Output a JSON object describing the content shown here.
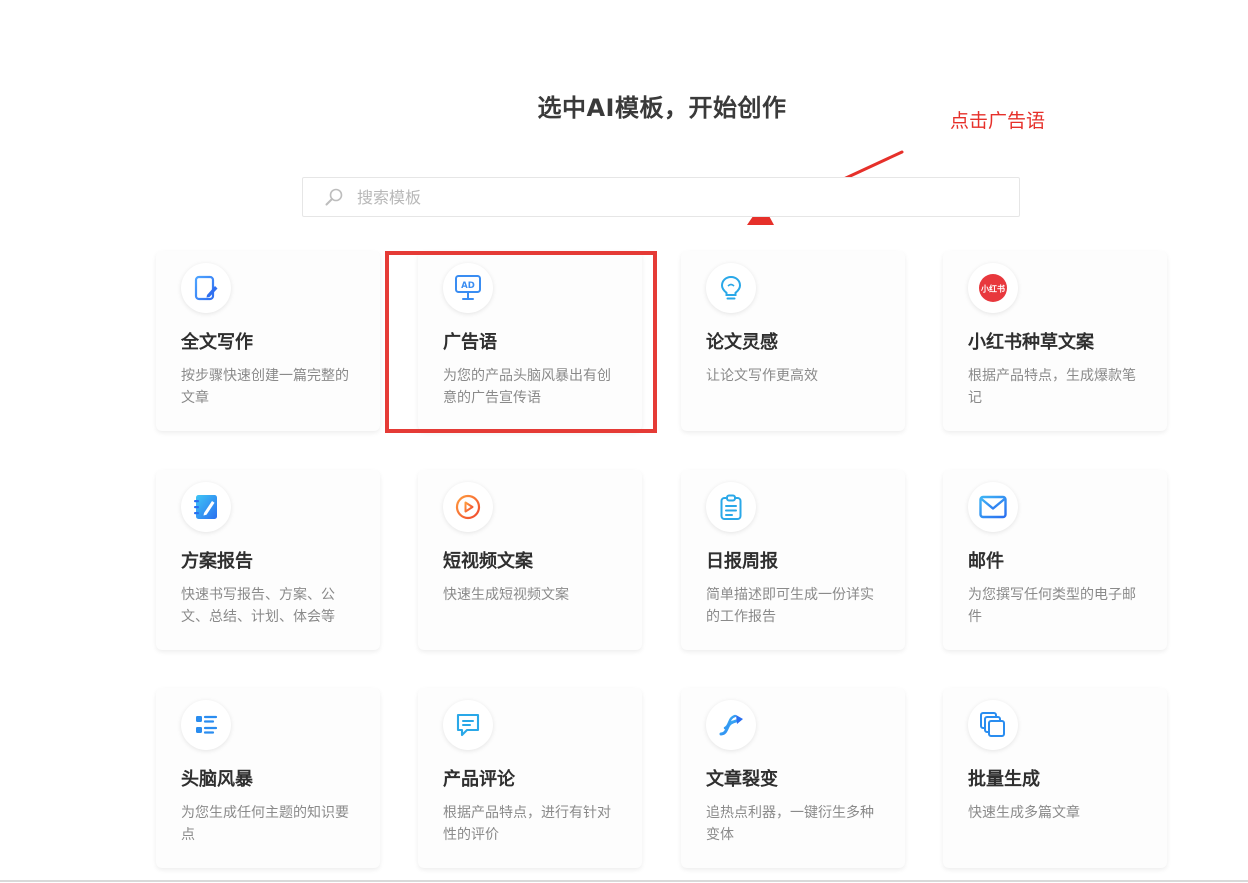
{
  "page": {
    "title": "选中AI模板，开始创作"
  },
  "annotation": {
    "label": "点击广告语",
    "color": "#e6302a"
  },
  "search": {
    "placeholder": "搜索模板",
    "value": "",
    "icon": "search-icon"
  },
  "highlight_color": "#e53b36",
  "cards": [
    {
      "title": "全文写作",
      "desc": "按步骤快速创建一篇完整的文章",
      "icon": "document-edit-icon"
    },
    {
      "title": "广告语",
      "desc": "为您的产品头脑风暴出有创意的广告宣传语",
      "icon": "ad-board-icon",
      "icon_text": "AD"
    },
    {
      "title": "论文灵感",
      "desc": "让论文写作更高效",
      "icon": "lightbulb-icon"
    },
    {
      "title": "小红书种草文案",
      "desc": "根据产品特点，生成爆款笔记",
      "icon": "xiaohongshu-logo-icon",
      "icon_text": "小红书"
    },
    {
      "title": "方案报告",
      "desc": "快速书写报告、方案、公文、总结、计划、体会等",
      "icon": "notebook-pen-icon"
    },
    {
      "title": "短视频文案",
      "desc": "快速生成短视频文案",
      "icon": "play-circle-icon"
    },
    {
      "title": "日报周报",
      "desc": "简单描述即可生成一份详实的工作报告",
      "icon": "clipboard-icon"
    },
    {
      "title": "邮件",
      "desc": "为您撰写任何类型的电子邮件",
      "icon": "envelope-icon"
    },
    {
      "title": "头脑风暴",
      "desc": "为您生成任何主题的知识要点",
      "icon": "list-icon"
    },
    {
      "title": "产品评论",
      "desc": "根据产品特点，进行有针对性的评价",
      "icon": "chat-bubble-icon"
    },
    {
      "title": "文章裂变",
      "desc": "追热点利器，一键衍生多种变体",
      "icon": "split-arrow-icon"
    },
    {
      "title": "批量生成",
      "desc": "快速生成多篇文章",
      "icon": "stacked-pages-icon"
    }
  ]
}
